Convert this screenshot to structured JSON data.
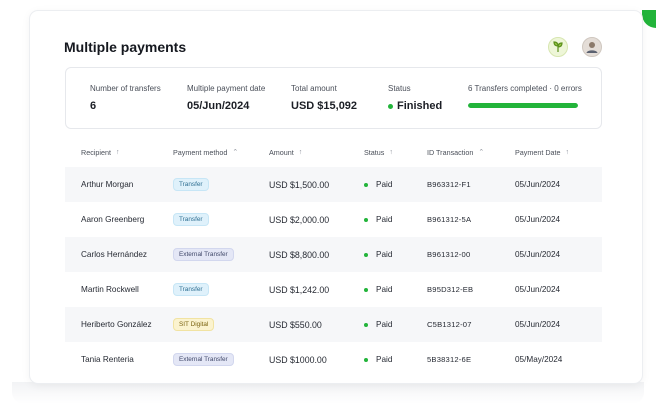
{
  "page": {
    "title": "Multiple payments"
  },
  "summary": {
    "transfers_label": "Number of transfers",
    "transfers_value": "6",
    "date_label": "Multiple payment date",
    "date_value": "05/Jun/2024",
    "total_label": "Total amount",
    "total_value": "USD $15,092",
    "status_label": "Status",
    "status_value": "Finished",
    "progress_label": "6 Transfers completed · 0 errors",
    "progress_percent": 100
  },
  "table": {
    "headers": [
      "Recipient",
      "Payment method",
      "Amount",
      "Status",
      "ID Transaction",
      "Payment Date"
    ],
    "rows": [
      {
        "recipient": "Arthur Morgan",
        "method": "Transfer",
        "method_kind": "transfer",
        "amount": "USD $1,500.00",
        "status": "Paid",
        "id": "B963312-F1",
        "date": "05/Jun/2024"
      },
      {
        "recipient": "Aaron Greenberg",
        "method": "Transfer",
        "method_kind": "transfer",
        "amount": "USD $2,000.00",
        "status": "Paid",
        "id": "B961312-5A",
        "date": "05/Jun/2024"
      },
      {
        "recipient": "Carlos Hernández",
        "method": "External Transfer",
        "method_kind": "external",
        "amount": "USD $8,800.00",
        "status": "Paid",
        "id": "B961312-00",
        "date": "05/Jun/2024"
      },
      {
        "recipient": "Martin Rockwell",
        "method": "Transfer",
        "method_kind": "transfer",
        "amount": "USD $1,242.00",
        "status": "Paid",
        "id": "B95D312-EB",
        "date": "05/Jun/2024"
      },
      {
        "recipient": "Heriberto González",
        "method": "SIT Digital",
        "method_kind": "sit",
        "amount": "USD $550.00",
        "status": "Paid",
        "id": "C5B1312-07",
        "date": "05/Jun/2024"
      },
      {
        "recipient": "Tania Renteria",
        "method": "External Transfer",
        "method_kind": "external",
        "amount": "USD $1000.00",
        "status": "Paid",
        "id": "5B38312-6E",
        "date": "05/May/2024"
      }
    ]
  },
  "colors": {
    "accent": "#22b43a"
  },
  "icons": {
    "sort": "sort-arrow-icon",
    "logo": "company-logo-icon",
    "user": "user-avatar-icon"
  }
}
